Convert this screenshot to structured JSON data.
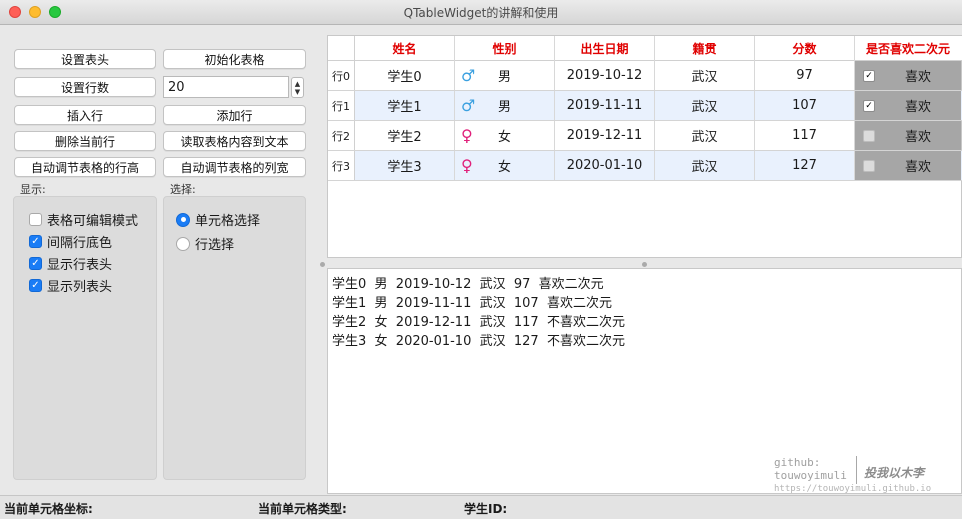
{
  "window": {
    "title": "QTableWidget的讲解和使用"
  },
  "buttons": {
    "set_header": "设置表头",
    "init_table": "初始化表格",
    "set_rows": "设置行数",
    "insert_row": "插入行",
    "add_row": "添加行",
    "delete_row": "删除当前行",
    "read_to_text": "读取表格内容到文本",
    "auto_row_height": "自动调节表格的行高",
    "auto_col_width": "自动调节表格的列宽"
  },
  "row_count": {
    "value": "20"
  },
  "display_group": {
    "label": "显示:",
    "options": [
      {
        "label": "表格可编辑模式",
        "checked": false
      },
      {
        "label": "间隔行底色",
        "checked": true
      },
      {
        "label": "显示行表头",
        "checked": true
      },
      {
        "label": "显示列表头",
        "checked": true
      }
    ]
  },
  "select_group": {
    "label": "选择:",
    "options": [
      {
        "label": "单元格选择",
        "checked": true
      },
      {
        "label": "行选择",
        "checked": false
      }
    ]
  },
  "table": {
    "headers": [
      "姓名",
      "性别",
      "出生日期",
      "籍贯",
      "分数",
      "是否喜欢二次元"
    ],
    "rows": [
      {
        "head": "行0",
        "name": "学生0",
        "gender_symbol": "♂",
        "gender": "男",
        "birth": "2019-10-12",
        "hometown": "武汉",
        "score": "97",
        "likes_checked": true,
        "likes": "喜欢"
      },
      {
        "head": "行1",
        "name": "学生1",
        "gender_symbol": "♂",
        "gender": "男",
        "birth": "2019-11-11",
        "hometown": "武汉",
        "score": "107",
        "likes_checked": true,
        "likes": "喜欢"
      },
      {
        "head": "行2",
        "name": "学生2",
        "gender_symbol": "♀",
        "gender": "女",
        "birth": "2019-12-11",
        "hometown": "武汉",
        "score": "117",
        "likes_checked": false,
        "likes": "喜欢"
      },
      {
        "head": "行3",
        "name": "学生3",
        "gender_symbol": "♀",
        "gender": "女",
        "birth": "2020-01-10",
        "hometown": "武汉",
        "score": "127",
        "likes_checked": false,
        "likes": "喜欢"
      }
    ]
  },
  "text_output": {
    "lines": [
      "学生0  男  2019-10-12  武汉  97  喜欢二次元",
      "学生1  男  2019-11-11  武汉  107  喜欢二次元",
      "学生2  女  2019-12-11  武汉  117  不喜欢二次元",
      "学生3  女  2020-01-10  武汉  127  不喜欢二次元"
    ]
  },
  "watermark": {
    "line1": "github:",
    "line2": "touwoyimuli",
    "right": "投我以木李",
    "url": "https://touwoyimuli.github.io"
  },
  "status": {
    "coord_label": "当前单元格坐标:",
    "type_label": "当前单元格类型:",
    "id_label": "学生ID:"
  },
  "colors": {
    "header_text": "#e00000",
    "male_symbol": "#3aa0e0",
    "female_symbol": "#e0207a",
    "alt_row": "#e9f1fd",
    "accent": "#1a7cf5"
  }
}
